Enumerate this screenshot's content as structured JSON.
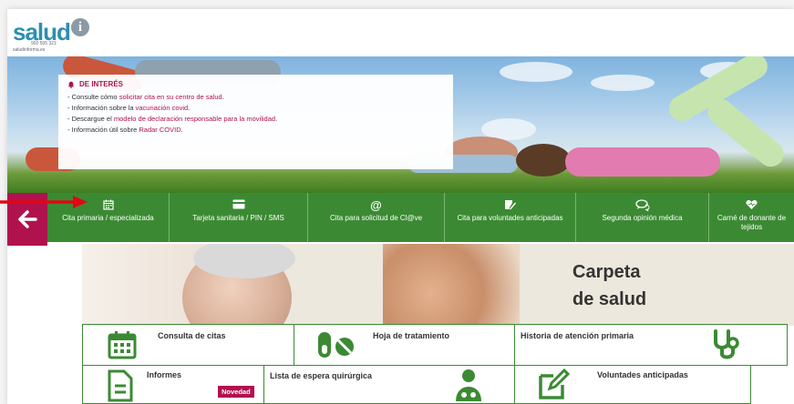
{
  "brand": {
    "name": "salud",
    "phone": "902 505 321",
    "site": "saludinforma.es"
  },
  "notice": {
    "title": "DE INTERÉS",
    "lines": [
      {
        "pre": "- Consulte cómo ",
        "link": "solicitar cita en su centro de salud",
        "post": "."
      },
      {
        "pre": "- Información sobre la ",
        "link": "vacunación covid",
        "post": "."
      },
      {
        "pre": "- Descargue el ",
        "link": "modelo de declaración responsable para la movilidad",
        "post": "."
      },
      {
        "pre": "- Información útil sobre ",
        "link": "Radar COVID",
        "post": "."
      }
    ]
  },
  "nav": {
    "items": [
      {
        "label": "Cita primaria / especializada",
        "icon": "calendar-icon"
      },
      {
        "label": "Tarjeta sanitaria / PIN / SMS",
        "icon": "card-icon"
      },
      {
        "label": "Cita para solicitud de Cl@ve",
        "icon": "at-icon"
      },
      {
        "label": "Cita para voluntades anticipadas",
        "icon": "signature-icon"
      },
      {
        "label": "Segunda opinión médica",
        "icon": "chat-icon"
      },
      {
        "label": "Carné de donante de tejidos",
        "icon": "heart-icon"
      }
    ]
  },
  "banner": {
    "title_line1": "Carpeta",
    "title_line2": "de salud"
  },
  "tiles": {
    "consulta": "Consulta de citas",
    "hoja": "Hoja de tratamiento",
    "historia": "Historia de atención primaria",
    "informes": "Informes",
    "novedad": "Novedad",
    "lista": "Lista de espera quirúrgica",
    "voluntades": "Voluntades anticipadas"
  },
  "colors": {
    "green": "#3b8a33",
    "magenta": "#b0124d",
    "brand_blue": "#2c8fb0"
  }
}
